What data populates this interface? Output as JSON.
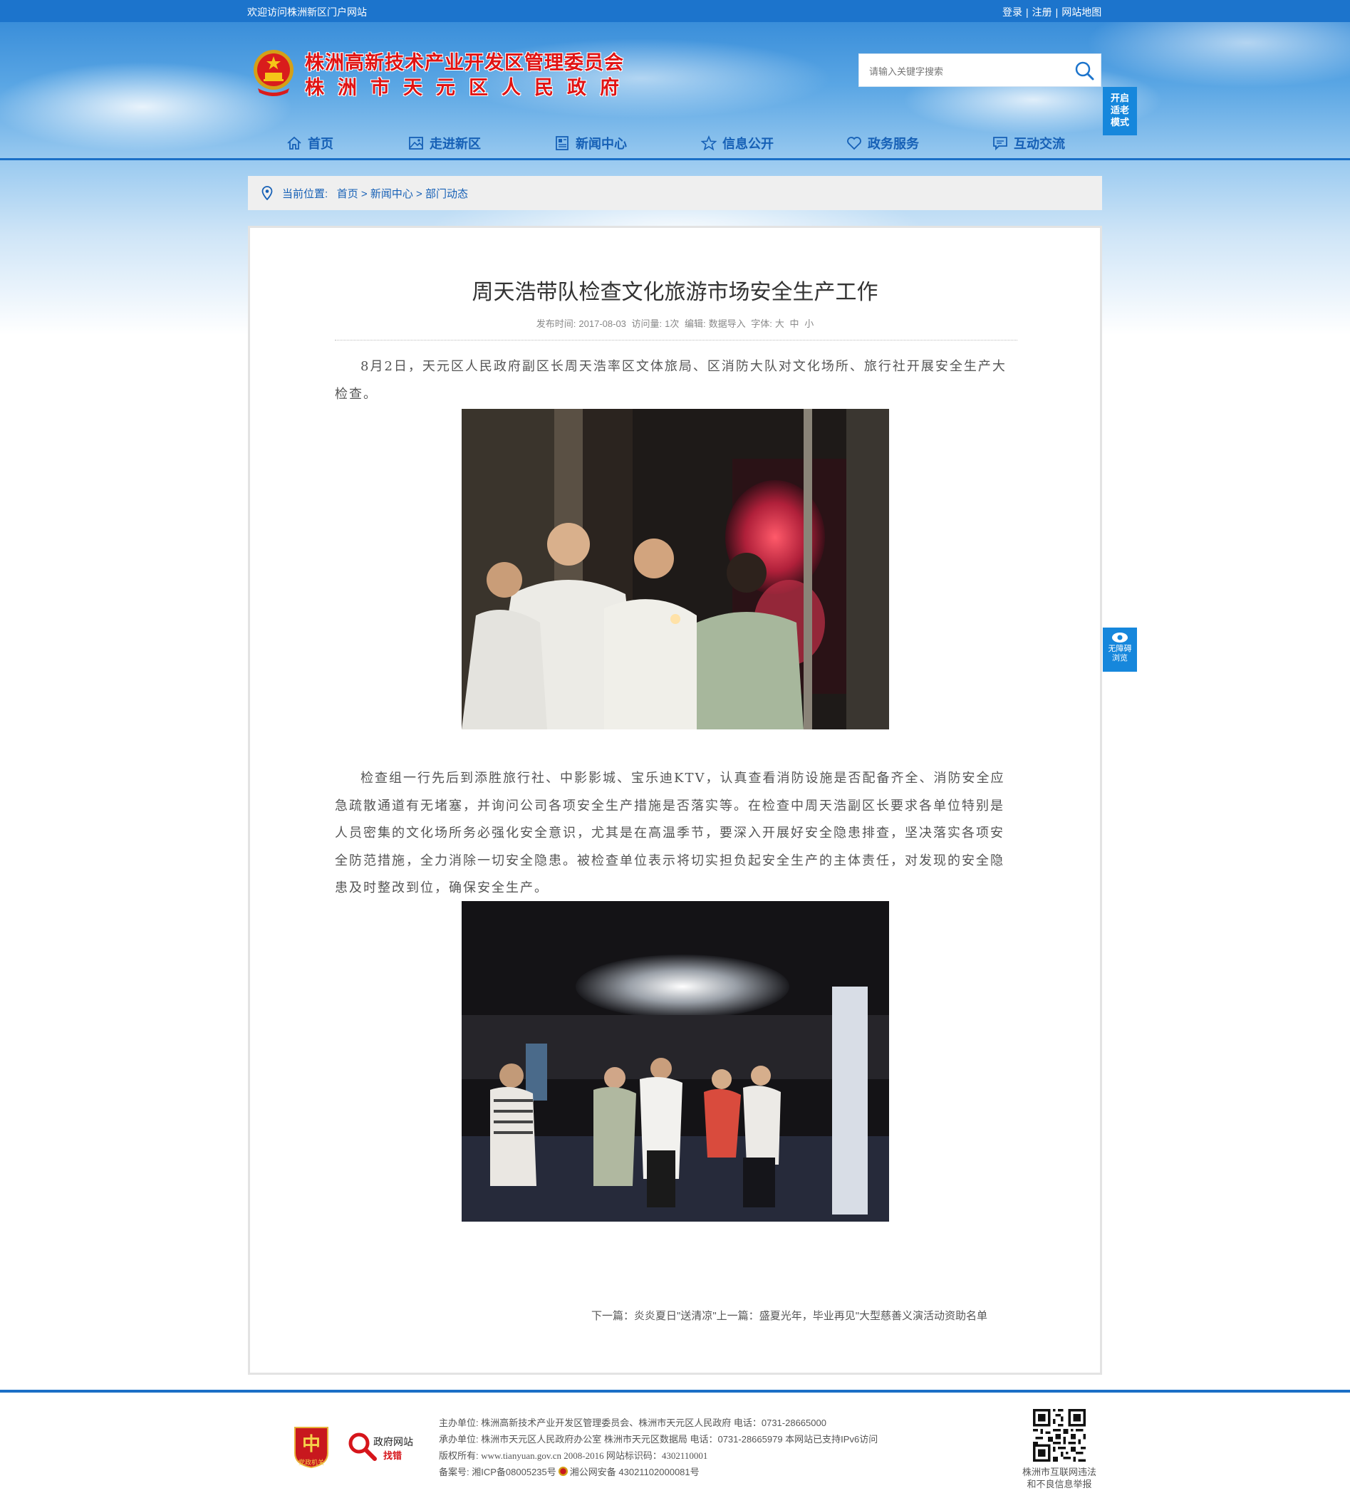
{
  "topbar": {
    "welcome": "欢迎访问株洲新区门户网站",
    "login": "登录",
    "register": "注册",
    "sitemap": "网站地图"
  },
  "header": {
    "title_line1": "株洲高新技术产业开发区管理委员会",
    "title_line2": "株洲市天元区人民政府",
    "search_placeholder": "请输入关键字搜索",
    "elder_mode": "开启适老模式",
    "elder_line1": "开启",
    "elder_line2": "适老",
    "elder_line3": "模式",
    "accessibility_line1": "无障碍",
    "accessibility_line2": "浏览"
  },
  "nav": [
    {
      "label": "首页",
      "icon": "home-icon"
    },
    {
      "label": "走进新区",
      "icon": "image-icon"
    },
    {
      "label": "新闻中心",
      "icon": "newspaper-icon"
    },
    {
      "label": "信息公开",
      "icon": "star-icon"
    },
    {
      "label": "政务服务",
      "icon": "heart-icon"
    },
    {
      "label": "互动交流",
      "icon": "chat-icon"
    }
  ],
  "breadcrumb": {
    "label": "当前位置:",
    "items": [
      "首页",
      "新闻中心",
      "部门动态"
    ],
    "sep": ">"
  },
  "article": {
    "title": "周天浩带队检查文化旅游市场安全生产工作",
    "publish_label": "发布时间:",
    "publish_date": "2017-08-03",
    "views_label": "访问量:",
    "views": "1次",
    "editor_label": "编辑:",
    "editor": "数据导入",
    "font_label": "字体:",
    "font_sizes": [
      "大",
      "中",
      "小"
    ],
    "para1": "8月2日，天元区人民政府副区长周天浩率区文体旅局、区消防大队对文化场所、旅行社开展安全生产大检查。",
    "para2": "检查组一行先后到添胜旅行社、中影影城、宝乐迪KTV，认真查看消防设施是否配备齐全、消防安全应急疏散通道有无堵塞，并询问公司各项安全生产措施是否落实等。在检查中周天浩副区长要求各单位特别是人员密集的文化场所务必强化安全意识，尤其是在高温季节，要深入开展好安全隐患排查，坚决落实各项安全防范措施，全力消除一切安全隐患。被检查单位表示将切实担负起安全生产的主体责任，对发现的安全隐患及时整改到位，确保安全生产。",
    "next_label": "下一篇：",
    "next_title": "炎炎夏日\"送清凉\"",
    "prev_label": "上一篇：",
    "prev_title": "盛夏光年，毕业再见\"大型慈善义演活动资助名单"
  },
  "footer": {
    "host_label": "主办单位:",
    "host": "株洲高新技术产业开发区管理委员会、株洲市天元区人民政府 电话：0731-28665000",
    "undertake_label": "承办单位:",
    "undertake": "株洲市天元区人民政府办公室 株洲市天元区数据局 电话：0731-28665979 本网站已支持IPv6访问",
    "copyright_label": "版权所有:",
    "copyright": "www.tianyuan.gov.cn 2008-2016 网站标识码：4302110001",
    "record_label": "备案号:",
    "icp": "湘ICP备08005235号",
    "police": "湘公网安备 43021102000081号",
    "gov_error_line1": "政府网站",
    "gov_error_line2": "找错",
    "party_badge": "党政机关",
    "report_line1": "株洲市互联网违法",
    "report_line2": "和不良信息举报"
  },
  "colors": {
    "brand_blue": "#1c74cc",
    "title_red": "#e01414",
    "nav_blue": "#1660b6"
  }
}
